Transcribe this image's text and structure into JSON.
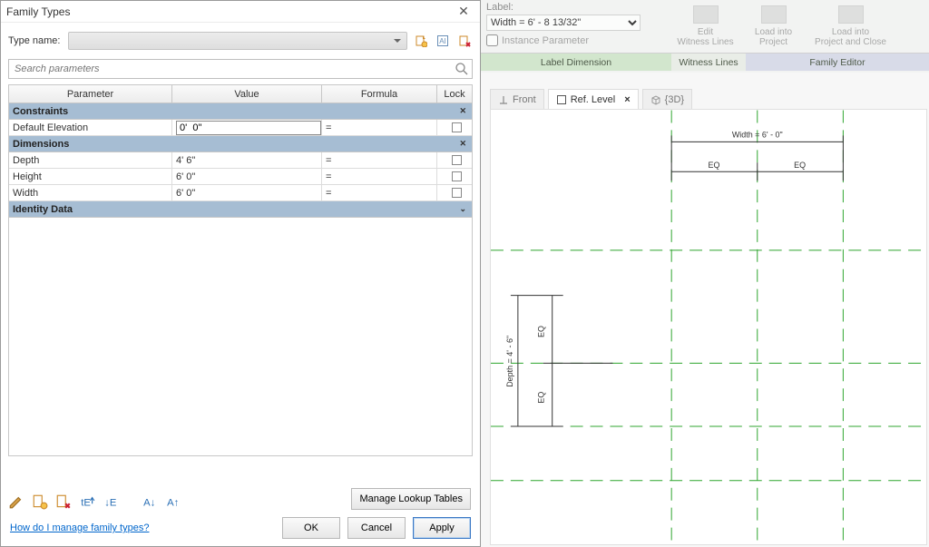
{
  "ribbon": {
    "label_caption": "Label:",
    "label_value": "Width = 6' - 8 13/32\"",
    "instance_param": "Instance Parameter",
    "buttons": {
      "edit_witness": "Edit\nWitness Lines",
      "load_project": "Load into\nProject",
      "load_close": "Load into\nProject and Close"
    },
    "panels": {
      "label_dim": "Label Dimension",
      "witness": "Witness Lines",
      "family_editor": "Family Editor"
    }
  },
  "view_tabs": {
    "front": "Front",
    "ref_level": "Ref. Level",
    "three_d": "{3D}"
  },
  "drawing": {
    "width_label": "Width = 6' - 0\"",
    "depth_label": "Depth = 4' - 6\"",
    "eq": "EQ"
  },
  "dialog": {
    "title": "Family Types",
    "type_name_label": "Type name:",
    "search_placeholder": "Search parameters",
    "headers": {
      "parameter": "Parameter",
      "value": "Value",
      "formula": "Formula",
      "lock": "Lock"
    },
    "groups": {
      "constraints": "Constraints",
      "dimensions": "Dimensions",
      "identity": "Identity Data"
    },
    "rows": {
      "default_elev": {
        "name": "Default Elevation",
        "value": "0'  0\"",
        "formula": "="
      },
      "depth": {
        "name": "Depth",
        "value": "4'  6\"",
        "formula": "="
      },
      "height": {
        "name": "Height",
        "value": "6'  0\"",
        "formula": "="
      },
      "width": {
        "name": "Width",
        "value": "6'  0\"",
        "formula": "="
      }
    },
    "manage_lookup": "Manage Lookup Tables",
    "help": "How do I manage family types?",
    "buttons": {
      "ok": "OK",
      "cancel": "Cancel",
      "apply": "Apply"
    }
  }
}
